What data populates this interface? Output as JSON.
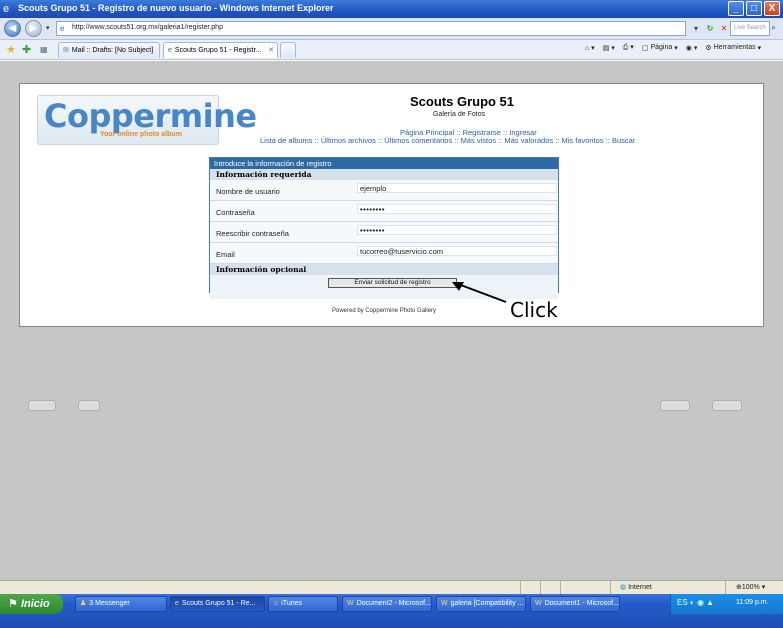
{
  "window": {
    "title": "Scouts Grupo 51 - Registro de nuevo usuario - Windows Internet Explorer",
    "minimize": "_",
    "maximize": "□",
    "close": "X"
  },
  "address_bar": {
    "url": "http://www.scouts51.org.mx/galeria1/register.php",
    "search_placeholder": "Live Search"
  },
  "tabs": [
    {
      "label": "Mail :: Drafts: [No Subject]"
    },
    {
      "label": "Scouts Grupo 51 - Registr..."
    }
  ],
  "toolbar": {
    "page_label": "Página",
    "tools_label": "Herramientas"
  },
  "site": {
    "logo_text": "Coppermine",
    "logo_tagline": "Your online photo album",
    "title": "Scouts Grupo 51",
    "subtitle": "Galería de Fotos",
    "nav_row1": [
      "Página Principal",
      "Registrarse",
      "Ingresar"
    ],
    "nav_row2": [
      "Lista de albums",
      "Últimos archivos",
      "Últimos comentarios",
      "Más vistos",
      "Más valorados",
      "Mis favoritos",
      "Buscar"
    ],
    "separator": "::",
    "powered_by": "Powered by Coppermine Photo Gallery"
  },
  "form": {
    "header": "Introduce la información de registro",
    "required_section": "Información requerida",
    "fields": [
      {
        "label": "Nombre de usuario",
        "value": "ejemplo"
      },
      {
        "label": "Contraseña",
        "value": "••••••••"
      },
      {
        "label": "Reescribir contraseña",
        "value": "••••••••"
      },
      {
        "label": "Email",
        "value": "tucorreo@tuservicio.com"
      }
    ],
    "optional_section": "Información opcional",
    "submit_label": "Enviar solicitud de registro"
  },
  "annotation": {
    "label": "Click"
  },
  "status_bar": {
    "zone": "Internet",
    "zoom": "100%"
  },
  "taskbar": {
    "start_label": "Inicio",
    "tasks": [
      {
        "label": "3 Messenger"
      },
      {
        "label": "Scouts Grupo 51 - Re..."
      },
      {
        "label": "iTunes"
      },
      {
        "label": "Document2 - Microsof..."
      },
      {
        "label": "galeria [Compatibility ..."
      },
      {
        "label": "Document1 - Microsof..."
      }
    ],
    "clock": "11:09 p.m."
  },
  "colors": {
    "form_header": "#2d6aa3",
    "link": "#2a5fa6",
    "logo": "#4887c6",
    "page_background": "#c6c6c6"
  }
}
